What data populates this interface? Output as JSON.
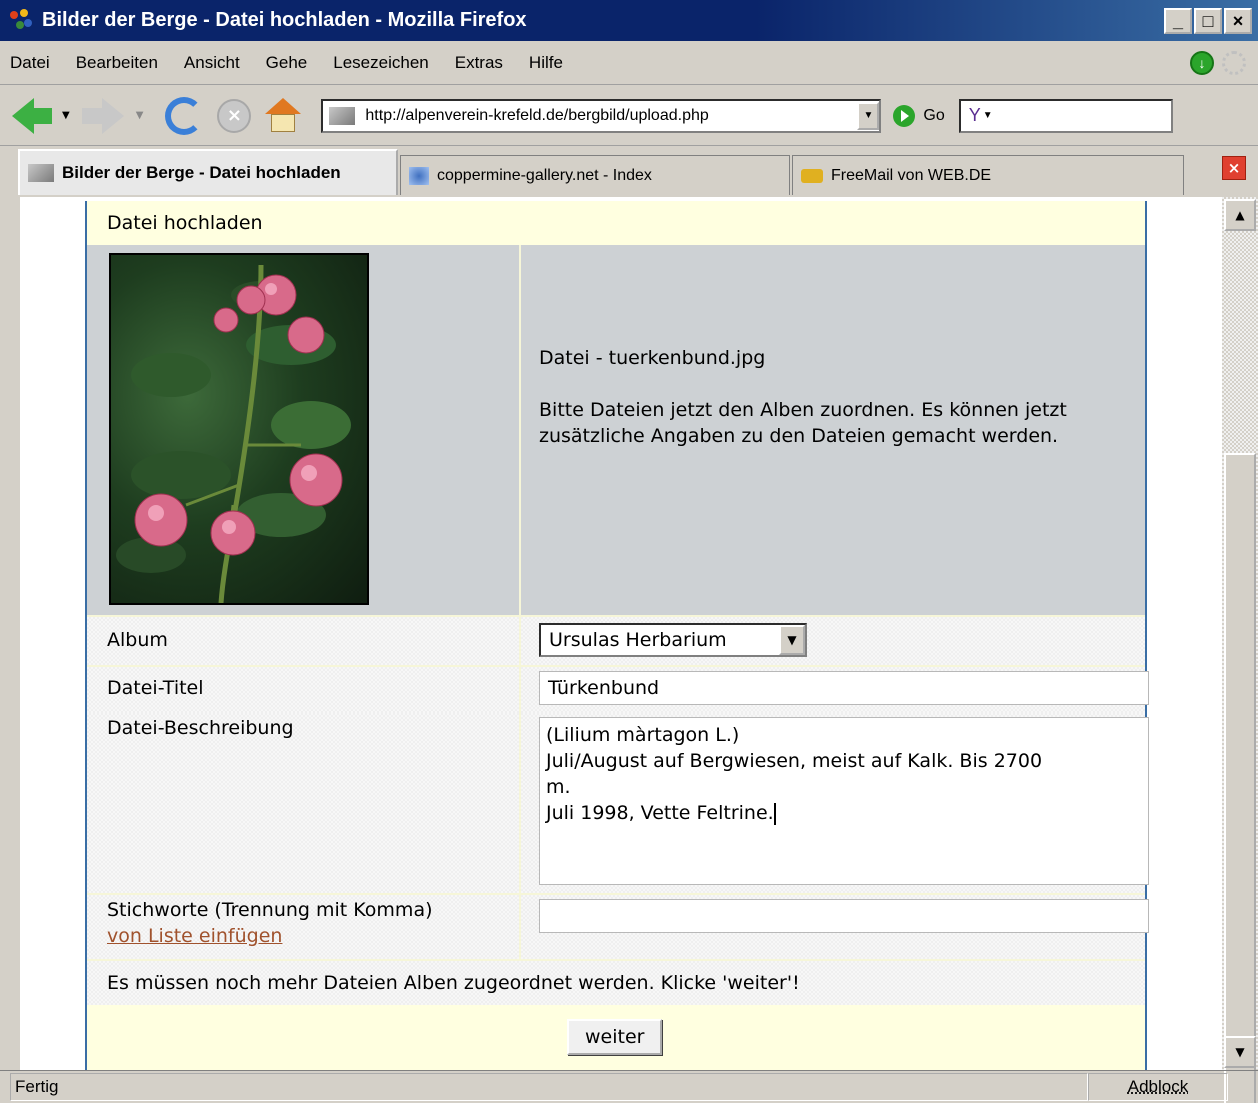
{
  "window": {
    "title": "Bilder der Berge - Datei hochladen - Mozilla Firefox",
    "controls": [
      "_",
      "□",
      "×"
    ]
  },
  "menu": [
    "Datei",
    "Bearbeiten",
    "Ansicht",
    "Gehe",
    "Lesezeichen",
    "Extras",
    "Hilfe"
  ],
  "toolbar": {
    "url": "http://alpenverein-krefeld.de/bergbild/upload.php",
    "go_label": "Go",
    "search_text": "Y"
  },
  "tabs": [
    {
      "label": "Bilder der Berge - Datei hochladen",
      "active": true
    },
    {
      "label": "coppermine-gallery.net - Index",
      "active": false
    },
    {
      "label": "FreeMail von WEB.DE",
      "active": false
    }
  ],
  "page": {
    "header": "Datei hochladen",
    "file_line": "Datei - tuerkenbund.jpg",
    "instructions": "Bitte Dateien jetzt den Alben zuordnen. Es können jetzt zusätzliche Angaben zu den Dateien gemacht werden.",
    "album_label": "Album",
    "album_value": "Ursulas Herbarium",
    "title_label": "Datei-Titel",
    "title_value": "Türkenbund",
    "desc_label": "Datei-Beschreibung",
    "desc_value": "(Lilium màrtagon L.)\nJuli/August auf Bergwiesen, meist auf Kalk. Bis 2700\nm.\nJuli 1998, Vette Feltrine.",
    "keywords_label": "Stichworte (Trennung mit Komma)",
    "keywords_link": "von Liste einfügen",
    "keywords_value": "",
    "notice": "Es müssen noch mehr Dateien Alben zugeordnet werden. Klicke 'weiter'!",
    "button": "weiter"
  },
  "statusbar": {
    "status": "Fertig",
    "adblock": "Adblock"
  },
  "colors": {
    "titlebar": "#0a246a",
    "header_bg": "#ffffe0",
    "image_row_bg": "#cdd1d4",
    "link": "#a0522d"
  }
}
